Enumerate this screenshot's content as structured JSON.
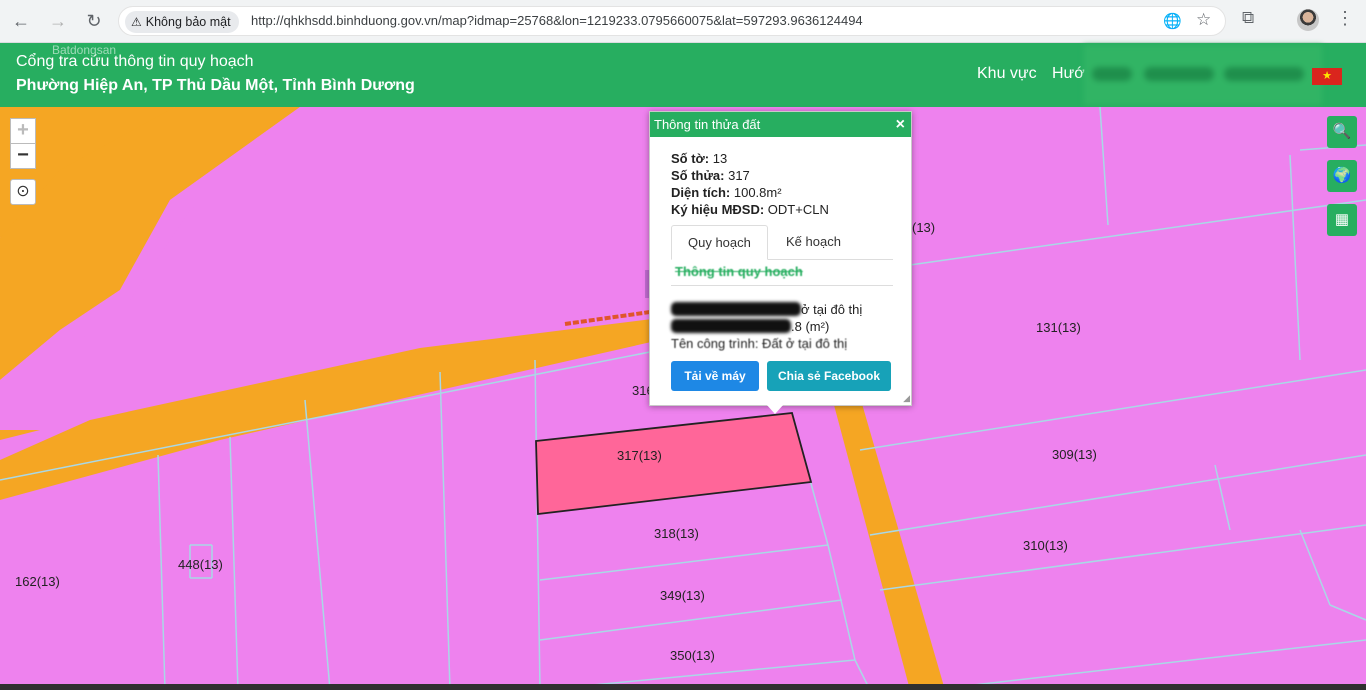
{
  "browser": {
    "nav": {
      "back_icon": "←",
      "forward_icon": "→",
      "reload_icon": "↻"
    },
    "security_label": "Không bảo mật",
    "url": "http://qhkhsdd.binhduong.gov.vn/map?idmap=25768&lon=1219233.0795660075&lat=597293.9636124494",
    "icons": {
      "translate": "🌐",
      "star": "☆",
      "extensions": "⧉",
      "menu": "⋮"
    }
  },
  "header": {
    "watermark": "Batdongsan",
    "title": "Cổng tra cứu thông tin quy hoạch",
    "location": "Phường Hiệp An, TP Thủ Dầu Một, Tỉnh Bình Dương",
    "nav_items": [
      "Khu vực",
      "Hướ"
    ],
    "flag": "★"
  },
  "map_controls": {
    "zoom_in": "+",
    "zoom_out": "−",
    "locate": "⊙",
    "side_buttons": [
      "🔍",
      "🌍",
      "▦"
    ]
  },
  "popup": {
    "title": "Thông tin thửa đất",
    "close": "×",
    "fields": [
      {
        "label": "Số tờ:",
        "value": "13"
      },
      {
        "label": "Số thửa:",
        "value": "317"
      },
      {
        "label": "Diện tích:",
        "value": "100.8m²"
      },
      {
        "label": "Ký hiệu MĐSD:",
        "value": "ODT+CLN"
      }
    ],
    "tabs": [
      "Quy hoạch",
      "Kế hoạch"
    ],
    "section_heading": "Thông tin quy hoạch",
    "plan_lines": [
      "ở tại đô thị",
      ".8 (m²)",
      "Tên công trình: Đất ở tại đô thị"
    ],
    "download_label": "Tải về máy",
    "share_label": "Chia sẻ Facebook"
  },
  "parcels": [
    "317(13)",
    "318(13)",
    "349(13)",
    "350(13)",
    "309(13)",
    "310(13)",
    "131(13)",
    "448(13)",
    "162(13)",
    "316",
    "(13)"
  ],
  "colors": {
    "green": "#27ae60",
    "land_pink": "#ee82ee",
    "road_orange": "#f5a623",
    "selected_parcel": "#ff6699"
  }
}
